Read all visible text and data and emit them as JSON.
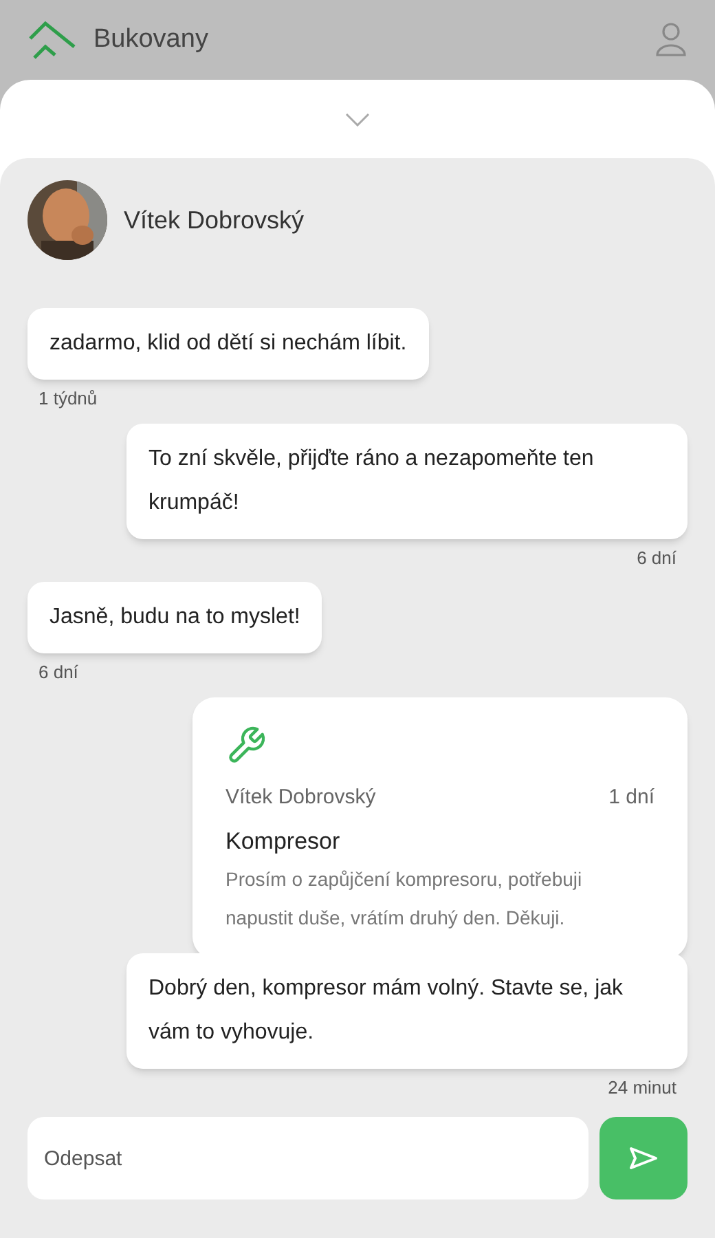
{
  "app": {
    "name": "Bukovany"
  },
  "chat": {
    "contact_name": "Vítek Dobrovský"
  },
  "messages": [
    {
      "kind": "text",
      "outgoing": false,
      "text": "zadarmo, klid od dětí si nechám líbit.",
      "time": "1 týdnů"
    },
    {
      "kind": "text",
      "outgoing": true,
      "text": "To zní skvěle, přijďte ráno a nezapomeňte ten krumpáč!",
      "time": "6 dní"
    },
    {
      "kind": "text",
      "outgoing": false,
      "text": "Jasně, budu na to myslet!",
      "time": "6 dní"
    },
    {
      "kind": "request",
      "outgoing": true,
      "request": {
        "sender": "Vítek Dobrovský",
        "time": "1 dní",
        "title": "Kompresor",
        "body": "Prosím o zapůjčení kompresoru, potřebuji napustit duše, vrátím druhý den. Děkuji."
      },
      "text": "Dobrý den, kompresor mám volný. Stavte se, jak vám to vyhovuje.",
      "time": "24 minut"
    }
  ],
  "composer": {
    "placeholder": "Odepsat"
  }
}
